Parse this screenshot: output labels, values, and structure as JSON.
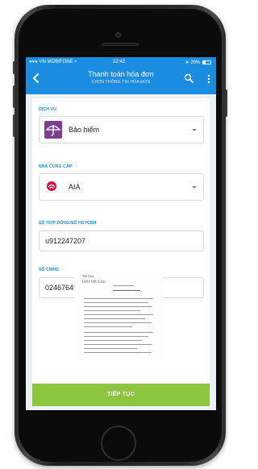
{
  "status_bar": {
    "carrier": "VN MOBIFONE",
    "time": "22:42",
    "battery": "20%"
  },
  "header": {
    "title": "Thanh toán hóa đơn",
    "subtitle": "CHỌN THÔNG TIN HÓA ĐƠN",
    "back_icon": "chevron-left-icon",
    "search_icon": "search-icon",
    "more_icon": "more-vertical-icon"
  },
  "form": {
    "service_label": "DỊCH VỤ",
    "service_value": "Bảo hiểm",
    "provider_label": "NHÀ CUNG CẤP",
    "provider_value": "AIA",
    "contract_label": "SỐ HỢP ĐỒNG/SỐ HSYCBH",
    "contract_value": "u912247207",
    "id_label": "SỐ CMND",
    "id_value": "024676456"
  },
  "document": {
    "line1": "The Gioi",
    "line2": "GIẤY YÊU CẦU"
  },
  "actions": {
    "continue_label": "TIẾP TỤC"
  },
  "colors": {
    "header_blue": "#1a8de0",
    "accent_green": "#8cc63e",
    "insurance_purple": "#7b3f8f",
    "aia_red": "#d31145"
  }
}
